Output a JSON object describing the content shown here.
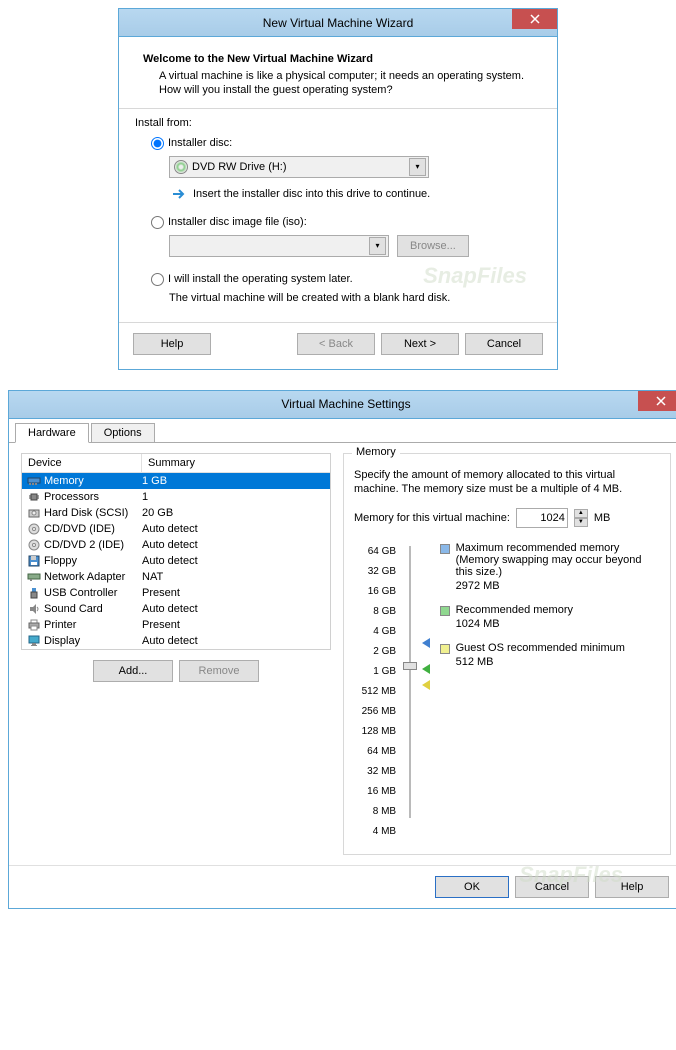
{
  "win1": {
    "title": "New Virtual Machine Wizard",
    "welcome_title": "Welcome to the New Virtual Machine Wizard",
    "welcome_desc": "A virtual machine is like a physical computer; it needs an operating system. How will you install the guest operating system?",
    "install_from": "Install from:",
    "opt_disc": "Installer disc:",
    "drive_value": "DVD RW Drive (H:)",
    "hint": "Insert the installer disc into this drive to continue.",
    "opt_iso": "Installer disc image file (iso):",
    "browse": "Browse...",
    "opt_later": "I will install the operating system later.",
    "later_note": "The virtual machine will be created with a blank hard disk.",
    "help": "Help",
    "back": "< Back",
    "next": "Next >",
    "cancel": "Cancel"
  },
  "watermark": "SnapFiles",
  "win2": {
    "title": "Virtual Machine Settings",
    "tab_hardware": "Hardware",
    "tab_options": "Options",
    "col_device": "Device",
    "col_summary": "Summary",
    "devices": [
      {
        "name": "Memory",
        "summary": "1 GB",
        "icon": "memory"
      },
      {
        "name": "Processors",
        "summary": "1",
        "icon": "cpu"
      },
      {
        "name": "Hard Disk (SCSI)",
        "summary": "20 GB",
        "icon": "hdd"
      },
      {
        "name": "CD/DVD (IDE)",
        "summary": "Auto detect",
        "icon": "cd"
      },
      {
        "name": "CD/DVD 2 (IDE)",
        "summary": "Auto detect",
        "icon": "cd"
      },
      {
        "name": "Floppy",
        "summary": "Auto detect",
        "icon": "floppy"
      },
      {
        "name": "Network Adapter",
        "summary": "NAT",
        "icon": "net"
      },
      {
        "name": "USB Controller",
        "summary": "Present",
        "icon": "usb"
      },
      {
        "name": "Sound Card",
        "summary": "Auto detect",
        "icon": "sound"
      },
      {
        "name": "Printer",
        "summary": "Present",
        "icon": "printer"
      },
      {
        "name": "Display",
        "summary": "Auto detect",
        "icon": "display"
      }
    ],
    "add": "Add...",
    "remove": "Remove",
    "group_title": "Memory",
    "mem_desc": "Specify the amount of memory allocated to this virtual machine. The memory size must be a multiple of 4 MB.",
    "mem_label": "Memory for this virtual machine:",
    "mem_value": "1024",
    "mem_unit": "MB",
    "ticks": [
      "64 GB",
      "32 GB",
      "16 GB",
      "8 GB",
      "4 GB",
      "2 GB",
      "1 GB",
      "512 MB",
      "256 MB",
      "128 MB",
      "64 MB",
      "32 MB",
      "16 MB",
      "8 MB",
      "4 MB"
    ],
    "leg_max": "Maximum recommended memory",
    "leg_max_sub": "(Memory swapping may occur beyond this size.)",
    "leg_max_val": "2972 MB",
    "leg_rec": "Recommended memory",
    "leg_rec_val": "1024 MB",
    "leg_min": "Guest OS recommended minimum",
    "leg_min_val": "512 MB",
    "ok": "OK",
    "cancel": "Cancel",
    "help": "Help"
  }
}
